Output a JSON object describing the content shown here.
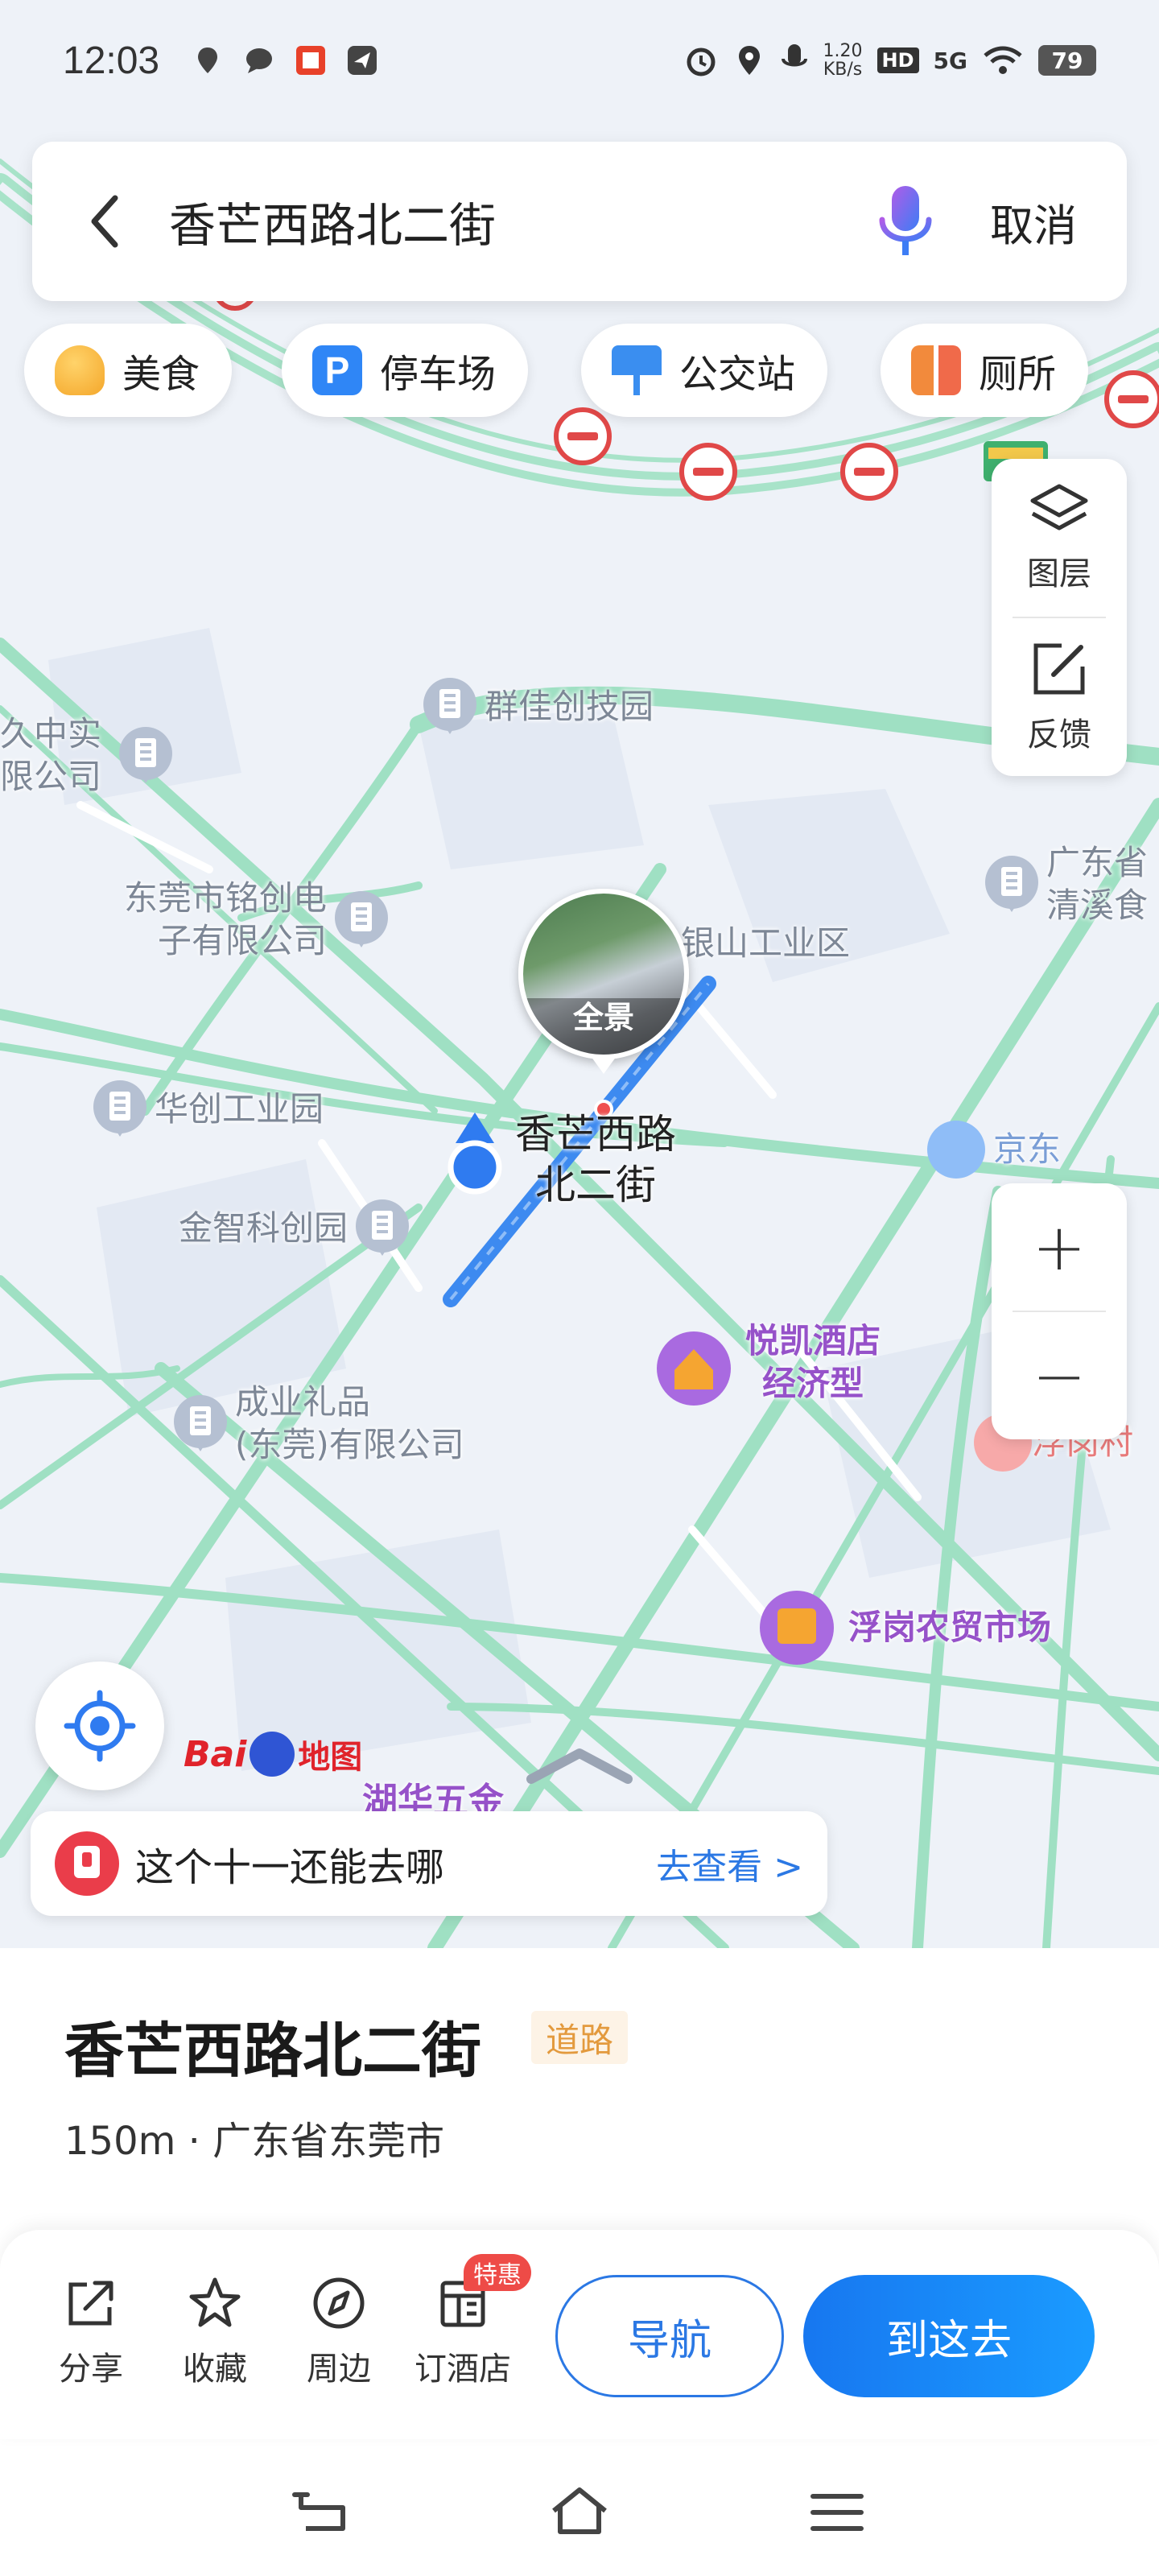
{
  "status_bar": {
    "time": "12:03",
    "net_speed": "1.20\nKB/s",
    "hd": "HD",
    "network": "5G",
    "battery": "79"
  },
  "search": {
    "query": "香芒西路北二街",
    "cancel_label": "取消"
  },
  "categories": [
    {
      "label": "美食",
      "icon": "food-icon",
      "color": "#f4b63b"
    },
    {
      "label": "停车场",
      "icon": "parking-icon",
      "color": "#2f86f6"
    },
    {
      "label": "公交站",
      "icon": "bus-stop-icon",
      "color": "#3a8ef0"
    },
    {
      "label": "厕所",
      "icon": "toilet-icon",
      "color": "#f28a3c"
    }
  ],
  "map_controls": {
    "layers_label": "图层",
    "feedback_label": "反馈",
    "zoom_in": "+",
    "zoom_out": "−"
  },
  "map_labels": {
    "poi_1": "群佳创技园",
    "poi_2_a": "久中实",
    "poi_2_b": "限公司",
    "poi_3_a": "东莞市铭创电",
    "poi_3_b": "子有限公司",
    "poi_4": "银山工业区",
    "poi_5_a": "广东省",
    "poi_5_b": "清溪食",
    "poi_6": "华创工业园",
    "poi_7": "金智科创园",
    "poi_8": "京东",
    "poi_9_a": "成业礼品",
    "poi_9_b": "(东莞)有限公司",
    "hotel_a": "悦凯酒店",
    "hotel_b": "经济型",
    "village": "浮岗村",
    "market": "浮岗农贸市场",
    "street_a": "香芒西路",
    "street_b": "北二街",
    "panorama": "全景",
    "partial_bottom": "湖华五金",
    "logo_text": "Bai",
    "logo_suffix": "地图"
  },
  "promo": {
    "text": "这个十一还能去哪",
    "action": "去查看 >"
  },
  "place": {
    "name": "香芒西路北二街",
    "tag": "道路",
    "info": "150m · 广东省东莞市"
  },
  "actions": [
    {
      "label": "分享",
      "icon": "share-icon"
    },
    {
      "label": "收藏",
      "icon": "star-icon"
    },
    {
      "label": "周边",
      "icon": "compass-icon"
    },
    {
      "label": "订酒店",
      "icon": "hotel-icon"
    }
  ],
  "hotel_badge": "特惠",
  "buttons": {
    "navigate": "导航",
    "go_here": "到这去"
  }
}
